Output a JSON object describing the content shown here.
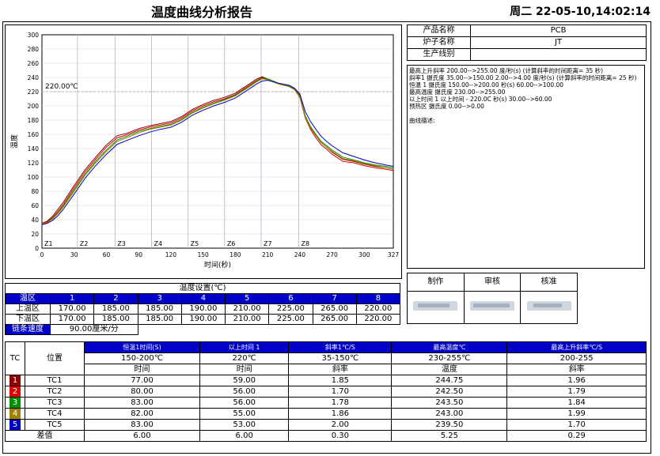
{
  "header": {
    "title": "温度曲线分析报告",
    "datetime": "周二 22-05-10,14:02:14"
  },
  "chart_data": {
    "type": "line",
    "xlabel": "时间(秒)",
    "ylabel": "温度",
    "xlim": [
      0,
      327
    ],
    "ylim": [
      0,
      300
    ],
    "xticks": [
      0,
      30,
      60,
      90,
      120,
      150,
      180,
      210,
      240,
      270,
      300,
      327
    ],
    "yticks": [
      0,
      20,
      40,
      60,
      80,
      100,
      120,
      140,
      160,
      180,
      200,
      220,
      240,
      260,
      280,
      300
    ],
    "threshold_label": "220.00℃",
    "threshold": 220,
    "zones": [
      {
        "label": "Z1",
        "x": 0
      },
      {
        "label": "Z2",
        "x": 33
      },
      {
        "label": "Z3",
        "x": 68
      },
      {
        "label": "Z4",
        "x": 102
      },
      {
        "label": "Z5",
        "x": 136
      },
      {
        "label": "Z6",
        "x": 170
      },
      {
        "label": "Z7",
        "x": 204
      },
      {
        "label": "Z8",
        "x": 239
      }
    ],
    "series": [
      {
        "name": "TC1",
        "color": "#8b0000",
        "x": [
          0,
          5,
          10,
          15,
          20,
          30,
          40,
          50,
          60,
          70,
          80,
          90,
          100,
          110,
          120,
          130,
          140,
          150,
          160,
          170,
          180,
          190,
          200,
          205,
          210,
          220,
          230,
          235,
          240,
          245,
          250,
          255,
          260,
          265,
          270,
          280,
          290,
          300,
          310,
          320,
          327
        ],
        "y": [
          35,
          38,
          45,
          55,
          65,
          88,
          110,
          128,
          145,
          158,
          162,
          168,
          172,
          175,
          178,
          185,
          195,
          202,
          208,
          212,
          218,
          228,
          238,
          241,
          238,
          232,
          228,
          225,
          215,
          185,
          170,
          158,
          148,
          142,
          135,
          125,
          122,
          118,
          115,
          113,
          111
        ]
      },
      {
        "name": "TC2",
        "color": "#e00000",
        "x": [
          0,
          5,
          10,
          15,
          20,
          30,
          40,
          50,
          60,
          70,
          80,
          90,
          100,
          110,
          120,
          130,
          140,
          150,
          160,
          170,
          180,
          190,
          200,
          205,
          210,
          220,
          230,
          235,
          240,
          245,
          250,
          255,
          260,
          265,
          270,
          280,
          290,
          300,
          310,
          320,
          327
        ],
        "y": [
          35,
          37,
          43,
          52,
          62,
          85,
          107,
          125,
          142,
          155,
          160,
          166,
          170,
          173,
          176,
          183,
          193,
          200,
          206,
          210,
          216,
          226,
          236,
          240,
          237,
          231,
          227,
          223,
          212,
          183,
          167,
          155,
          145,
          139,
          132,
          122,
          120,
          116,
          113,
          111,
          109
        ]
      },
      {
        "name": "TC3",
        "color": "#009000",
        "x": [
          0,
          5,
          10,
          15,
          20,
          30,
          40,
          50,
          60,
          70,
          80,
          90,
          100,
          110,
          120,
          130,
          140,
          150,
          160,
          170,
          180,
          190,
          200,
          205,
          210,
          220,
          230,
          235,
          240,
          245,
          250,
          255,
          260,
          265,
          270,
          280,
          290,
          300,
          310,
          320,
          327
        ],
        "y": [
          34,
          36,
          42,
          50,
          60,
          82,
          104,
          122,
          138,
          152,
          158,
          164,
          168,
          171,
          174,
          181,
          191,
          198,
          204,
          209,
          215,
          225,
          235,
          239,
          238,
          232,
          228,
          224,
          214,
          186,
          171,
          160,
          150,
          144,
          138,
          128,
          124,
          120,
          117,
          115,
          113
        ]
      },
      {
        "name": "TC4",
        "color": "#a08000",
        "x": [
          0,
          5,
          10,
          15,
          20,
          30,
          40,
          50,
          60,
          70,
          80,
          90,
          100,
          110,
          120,
          130,
          140,
          150,
          160,
          170,
          180,
          190,
          200,
          205,
          210,
          220,
          230,
          235,
          240,
          245,
          250,
          255,
          260,
          265,
          270,
          280,
          290,
          300,
          310,
          320,
          327
        ],
        "y": [
          34,
          36,
          41,
          49,
          58,
          80,
          102,
          120,
          136,
          150,
          156,
          162,
          167,
          170,
          173,
          180,
          190,
          197,
          203,
          208,
          214,
          224,
          234,
          238,
          237,
          231,
          227,
          223,
          213,
          184,
          169,
          158,
          148,
          142,
          136,
          126,
          123,
          119,
          116,
          113,
          111
        ]
      },
      {
        "name": "TC5",
        "color": "#0000c0",
        "x": [
          0,
          5,
          10,
          15,
          20,
          30,
          40,
          50,
          60,
          70,
          80,
          90,
          100,
          110,
          120,
          130,
          140,
          150,
          160,
          170,
          180,
          190,
          200,
          205,
          210,
          220,
          230,
          235,
          240,
          245,
          250,
          255,
          260,
          265,
          270,
          280,
          290,
          300,
          310,
          320,
          327
        ],
        "y": [
          33,
          35,
          39,
          46,
          55,
          76,
          98,
          116,
          132,
          146,
          152,
          158,
          163,
          167,
          170,
          177,
          187,
          194,
          200,
          205,
          211,
          221,
          231,
          235,
          236,
          232,
          229,
          225,
          217,
          192,
          178,
          167,
          157,
          150,
          144,
          134,
          129,
          124,
          120,
          117,
          115
        ]
      }
    ]
  },
  "info": {
    "product_label": "产品名称",
    "product_value": "PCB",
    "furnace_label": "炉子名称",
    "furnace_value": "JT",
    "line_label": "生产线别",
    "line_value": ""
  },
  "notes": {
    "lines": [
      "最高上升斜率    200.00-->255.00 度/秒(s) (计算斜率的时间距离= 35 秒)",
      "斜率1      摄氏度 35.00-->150.00 2.00-->4.00 度/秒(s) (计算斜率的时间距离= 25 秒)",
      "恒温 1      摄氏度 150.00-->200.00 秒(s) 60.00-->100.00",
      "最高温度       摄氏度 230.00-->255.00",
      "以上时间 1     以上时间  - 220.0C 秒(s) 30.00-->60.00",
      "预热区       摄氏度 0.00-->0.00",
      "",
      "曲线描述:"
    ]
  },
  "signoff": {
    "make": "制作",
    "review": "审核",
    "approve": "核准"
  },
  "zone_settings": {
    "title": "温度设置(℃)",
    "zone_label": "温区",
    "zones": [
      "1",
      "2",
      "3",
      "4",
      "5",
      "6",
      "7",
      "8"
    ],
    "upper_label": "上温区",
    "upper": [
      "170.00",
      "185.00",
      "185.00",
      "190.00",
      "210.00",
      "225.00",
      "265.00",
      "220.00"
    ],
    "lower_label": "下温区",
    "lower": [
      "170.00",
      "185.00",
      "185.00",
      "190.00",
      "210.00",
      "225.00",
      "265.00",
      "220.00"
    ],
    "speed_label": "链条速度",
    "speed_value": "90.00厘米/分"
  },
  "tc_table": {
    "tc_label": "TC",
    "pos_label": "位置",
    "headers": [
      "恒温1时间(S)",
      "以上时间 1",
      "斜率1℃/S",
      "最高温度℃",
      "最高上升斜率℃/S"
    ],
    "ranges": [
      "150-200℃",
      "220℃",
      "35-150℃",
      "230-255℃",
      "200-255"
    ],
    "units": [
      "时间",
      "时间",
      "斜率",
      "温度",
      "斜率"
    ],
    "rows": [
      {
        "tc": "1",
        "color": "#8b0000",
        "pos": "TC1",
        "vals": [
          "77.00",
          "59.00",
          "1.85",
          "244.75",
          "1.96"
        ]
      },
      {
        "tc": "2",
        "color": "#e00000",
        "pos": "TC2",
        "vals": [
          "80.00",
          "56.00",
          "1.70",
          "242.50",
          "1.79"
        ]
      },
      {
        "tc": "3",
        "color": "#009000",
        "pos": "TC3",
        "vals": [
          "83.00",
          "56.00",
          "1.78",
          "243.50",
          "1.84"
        ]
      },
      {
        "tc": "4",
        "color": "#a08000",
        "pos": "TC4",
        "vals": [
          "82.00",
          "55.00",
          "1.86",
          "243.00",
          "1.99"
        ]
      },
      {
        "tc": "5",
        "color": "#0000c0",
        "pos": "TC5",
        "vals": [
          "83.00",
          "53.00",
          "2.00",
          "239.50",
          "1.70"
        ]
      }
    ],
    "diff_label": "差值",
    "diff": [
      "6.00",
      "6.00",
      "0.30",
      "5.25",
      "0.29"
    ]
  }
}
